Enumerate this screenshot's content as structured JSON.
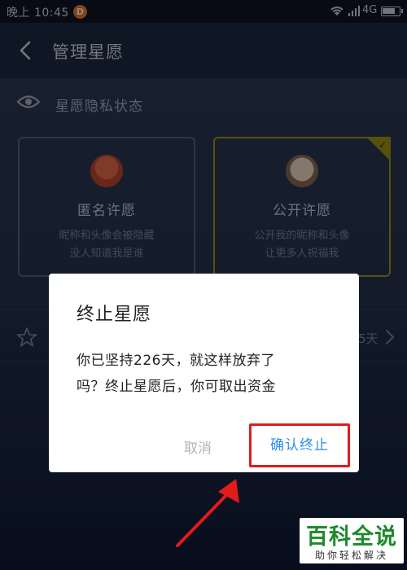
{
  "status_bar": {
    "time": "晚上 10:45",
    "notification_badge": "D",
    "network": "4G",
    "icons": [
      "wifi-icon",
      "signal-icon",
      "battery-icon"
    ]
  },
  "nav": {
    "title": "管理星愿",
    "back_icon": "chevron-left-icon"
  },
  "privacy": {
    "label": "星愿隐私状态",
    "icon": "eye-icon",
    "options": [
      {
        "title": "匿名许愿",
        "desc_line1": "昵称和头像会被隐藏",
        "desc_line2": "没人知道我是谁",
        "selected": false
      },
      {
        "title": "公开许愿",
        "desc_line1": "公开我的昵称和头像",
        "desc_line2": "让更多人祝福我",
        "selected": true
      }
    ]
  },
  "wish_row": {
    "icon": "star-icon",
    "days_suffix": "5天"
  },
  "dialog": {
    "title": "终止星愿",
    "message_line1": "你已坚持226天，就这样放弃了",
    "message_line2": "吗？终止星愿后，你可取出资金",
    "cancel_label": "取消",
    "confirm_label": "确认终止"
  },
  "annotation": {
    "highlight_color": "#e21b1b",
    "arrow_color": "#e21b1b"
  },
  "watermark": {
    "main": "百科全说",
    "sub": "助你轻松解决"
  },
  "colors": {
    "accent_blue": "#2e8cf0",
    "selected_gold": "#a39414",
    "watermark_green": "#1d8a2c"
  }
}
